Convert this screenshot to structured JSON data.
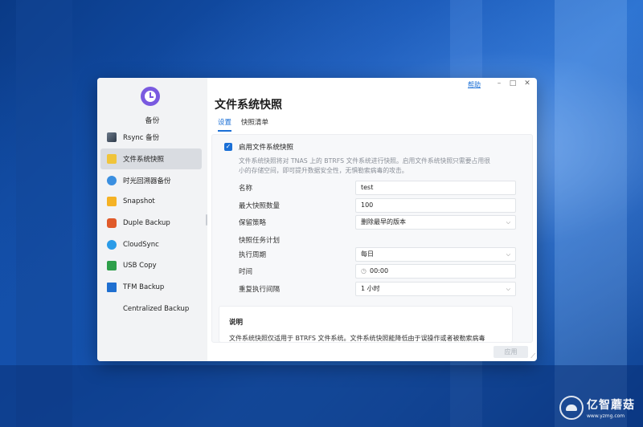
{
  "app": {
    "name": "备份",
    "accent": "#1a6fd6",
    "icon": "clock-backup-icon"
  },
  "window_controls": {
    "help": "帮助",
    "minimize": "–",
    "maximize": "□",
    "close": "✕"
  },
  "sidebar": {
    "items": [
      {
        "label": "Rsync 备份",
        "icon": "rsync-icon"
      },
      {
        "label": "文件系统快照",
        "icon": "filesystem-snapshot-icon",
        "active": true
      },
      {
        "label": "时光回溯器备份",
        "icon": "time-machine-icon"
      },
      {
        "label": "Snapshot",
        "icon": "snapshot-folder-icon"
      },
      {
        "label": "Duple Backup",
        "icon": "duple-backup-icon"
      },
      {
        "label": "CloudSync",
        "icon": "cloudsync-icon"
      },
      {
        "label": "USB Copy",
        "icon": "usb-copy-icon"
      },
      {
        "label": "TFM Backup",
        "icon": "tfm-backup-icon"
      },
      {
        "label": "Centralized Backup",
        "icon": ""
      }
    ]
  },
  "main": {
    "title": "文件系统快照",
    "tabs": [
      {
        "label": "设置",
        "active": true
      },
      {
        "label": "快照清单",
        "active": false
      }
    ],
    "enable_checkbox": {
      "label": "启用文件系统快照",
      "checked": true
    },
    "description_line1": "文件系统快照将对 TNAS 上的 BTRFS 文件系统进行快照。启用文件系统快照只需要占用很",
    "description_line2": "小的存储空间，即可提升数据安全性，无惧勒索病毒的攻击。",
    "fields": {
      "name": {
        "label": "名称",
        "value": "test"
      },
      "max_snapshots": {
        "label": "最大快照数量",
        "value": "100"
      },
      "retention": {
        "label": "保留策略",
        "value": "删除最早的版本"
      },
      "schedule_section": "快照任务计划",
      "period": {
        "label": "执行周期",
        "value": "每日"
      },
      "time": {
        "label": "时间",
        "value": "00:00"
      },
      "repeat": {
        "label": "重复执行间隔",
        "value": "1 小时"
      }
    },
    "note": {
      "title": "说明",
      "text": "文件系统快照仅适用于 BTRFS 文件系统。文件系统快照能降低由于误操作或者被勒索病毒"
    },
    "apply_button": "应用"
  },
  "watermark": {
    "brand": "亿智蘑菇",
    "url": "www.yzmg.com"
  }
}
